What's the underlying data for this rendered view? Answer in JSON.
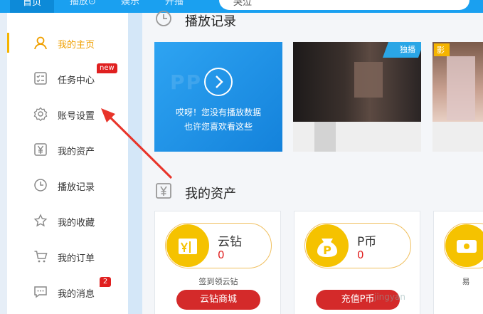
{
  "topbar": {
    "home_label": "首页",
    "nav": [
      "播放⊙",
      "娱乐",
      "开播"
    ],
    "search_text": "哭泣"
  },
  "sidebar": {
    "items": [
      {
        "label": "我的主页",
        "icon": "user-icon",
        "active": true
      },
      {
        "label": "任务中心",
        "icon": "task-list-icon",
        "badge": "new"
      },
      {
        "label": "账号设置",
        "icon": "gear-icon"
      },
      {
        "label": "我的资产",
        "icon": "yen-icon"
      },
      {
        "label": "播放记录",
        "icon": "clock-icon"
      },
      {
        "label": "我的收藏",
        "icon": "star-icon"
      },
      {
        "label": "我的订单",
        "icon": "cart-icon"
      },
      {
        "label": "我的消息",
        "icon": "message-icon",
        "badge": "2"
      }
    ]
  },
  "main": {
    "history_title": "播放记录",
    "history_empty_line1": "哎呀！您没有播放数据",
    "history_empty_line2": "也许您喜欢看这些",
    "thumbs": [
      {
        "caption": "",
        "sub": "",
        "tag": "独播"
      },
      {
        "caption": "",
        "sub": "",
        "tag": "影"
      }
    ],
    "assets_title": "我的资产",
    "assets": [
      {
        "name": "云钻",
        "value": "0",
        "hint": "签到领云钻",
        "button": "云钻商城",
        "icon": "diamond-box-icon"
      },
      {
        "name": "P币",
        "value": "0",
        "hint": "",
        "button": "充值P币",
        "icon": "coin-bag-icon"
      },
      {
        "name": "",
        "value": "",
        "hint": "易",
        "button": "",
        "icon": "ticket-icon"
      }
    ],
    "watermark_text": "jingyan"
  },
  "colors": {
    "accent_blue": "#1aa0f0",
    "active_yellow": "#f0a000",
    "badge_red": "#e02020",
    "annotation_arrow": "#e8342a"
  }
}
